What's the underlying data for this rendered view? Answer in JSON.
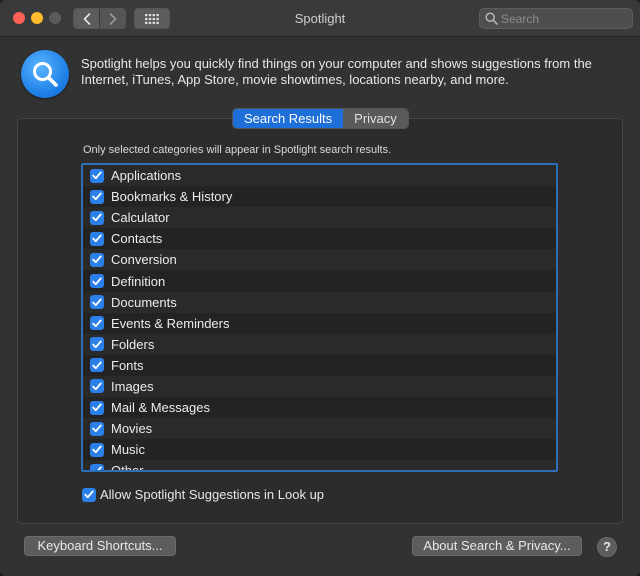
{
  "window": {
    "title": "Spotlight"
  },
  "toolbar": {
    "back_icon": "chevron-left-icon",
    "forward_icon": "chevron-right-icon",
    "grid_icon": "show-all-grid-icon",
    "search_placeholder": "Search"
  },
  "header": {
    "icon": "spotlight-magnifier-icon",
    "description": "Spotlight helps you quickly find things on your computer and shows suggestions from the Internet, iTunes, App Store, movie showtimes, locations nearby, and more."
  },
  "tabs": [
    {
      "label": "Search Results",
      "active": true
    },
    {
      "label": "Privacy",
      "active": false
    }
  ],
  "results": {
    "note": "Only selected categories will appear in Spotlight search results.",
    "categories": [
      {
        "label": "Applications",
        "checked": true
      },
      {
        "label": "Bookmarks & History",
        "checked": true
      },
      {
        "label": "Calculator",
        "checked": true
      },
      {
        "label": "Contacts",
        "checked": true
      },
      {
        "label": "Conversion",
        "checked": true
      },
      {
        "label": "Definition",
        "checked": true
      },
      {
        "label": "Documents",
        "checked": true
      },
      {
        "label": "Events & Reminders",
        "checked": true
      },
      {
        "label": "Folders",
        "checked": true
      },
      {
        "label": "Fonts",
        "checked": true
      },
      {
        "label": "Images",
        "checked": true
      },
      {
        "label": "Mail & Messages",
        "checked": true
      },
      {
        "label": "Movies",
        "checked": true
      },
      {
        "label": "Music",
        "checked": true
      },
      {
        "label": "Other",
        "checked": true
      }
    ],
    "allow_suggestions": {
      "label": "Allow Spotlight Suggestions in Look up",
      "checked": true
    }
  },
  "footer": {
    "keyboard_shortcuts_label": "Keyboard Shortcuts...",
    "about_label": "About Search & Privacy...",
    "help_label": "?"
  },
  "colors": {
    "accent": "#1f6fd8",
    "checkbox": "#2a7fe8",
    "list_border": "#2a6fb8",
    "window_bg": "#323232"
  }
}
